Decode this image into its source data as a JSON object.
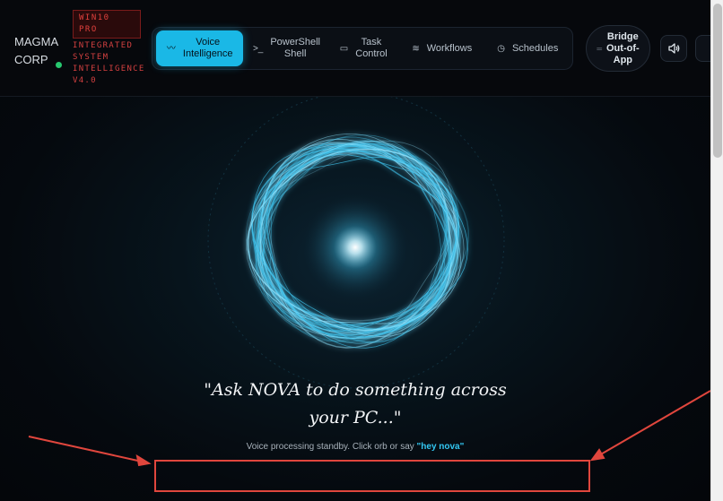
{
  "brand": {
    "line1": "MAGMA",
    "line2": "CORP"
  },
  "edition": {
    "line1": "WIN10",
    "line2": "PRO"
  },
  "system_tag": [
    "INTEGRATED",
    "SYSTEM",
    "INTELLIGENCE",
    "V4.0"
  ],
  "nav": {
    "items": [
      {
        "line1": "Voice",
        "line2": "Intelligence",
        "icon": "wave-icon",
        "active": true
      },
      {
        "line1": "PowerShell",
        "line2": "Shell",
        "icon": "terminal-icon"
      },
      {
        "line1": "Task",
        "line2": "Control",
        "icon": "monitor-icon"
      },
      {
        "line1": "Workflows",
        "line2": "",
        "icon": "layers-icon"
      },
      {
        "line1": "Schedules",
        "line2": "",
        "icon": "clock-icon"
      }
    ]
  },
  "bridge": {
    "line1": "Bridge",
    "line2": "Out-of-",
    "line3": "App"
  },
  "hero": {
    "quote_line1": "\"Ask NOVA to do something across",
    "quote_line2": "your PC...\"",
    "hint_prefix": "Voice processing standby. Click orb or say ",
    "hint_wake": "\"hey nova\""
  },
  "colors": {
    "accent": "#1ab8e6",
    "orb": "#3fc6f0",
    "danger": "#e0463d",
    "status": "#27c76f"
  }
}
